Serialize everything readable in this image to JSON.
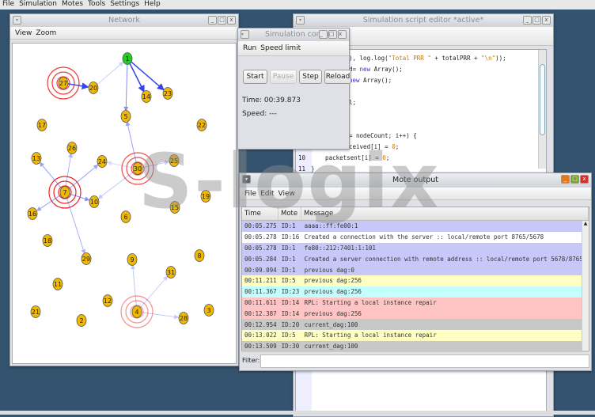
{
  "menubar": [
    "File",
    "Simulation",
    "Motes",
    "Tools",
    "Settings",
    "Help"
  ],
  "network": {
    "title": "Network",
    "menu": [
      "View",
      "Zoom"
    ],
    "nodes": [
      "1",
      "2",
      "3",
      "4",
      "5",
      "6",
      "7",
      "8",
      "9",
      "10",
      "11",
      "12",
      "13",
      "14",
      "15",
      "16",
      "17",
      "18",
      "19",
      "20",
      "21",
      "22",
      "23",
      "24",
      "25",
      "26",
      "27",
      "28",
      "29",
      "30",
      "31"
    ],
    "root_node": "1",
    "edges": [
      [
        "27",
        "20",
        1
      ],
      [
        "20",
        "1",
        0.25
      ],
      [
        "1",
        "14",
        1
      ],
      [
        "1",
        "23",
        1
      ],
      [
        "1",
        "5",
        0.6
      ],
      [
        "30",
        "5",
        0.5
      ],
      [
        "30",
        "24",
        0.2
      ],
      [
        "30",
        "25",
        0.3
      ],
      [
        "30",
        "10",
        0.3
      ],
      [
        "7",
        "13",
        0.5
      ],
      [
        "7",
        "26",
        0.4
      ],
      [
        "7",
        "24",
        0.5
      ],
      [
        "7",
        "16",
        0.5
      ],
      [
        "7",
        "10",
        0.6
      ],
      [
        "7",
        "29",
        0.4
      ],
      [
        "4",
        "9",
        0.3
      ],
      [
        "4",
        "31",
        0.25
      ],
      [
        "4",
        "28",
        0.3
      ]
    ],
    "transmitting": [
      [
        "27",
        0.9
      ],
      [
        "30",
        0.8
      ],
      [
        "7",
        1
      ],
      [
        "4",
        0.5
      ]
    ],
    "colors": {
      "node": "#f0b800",
      "root": "#22cc22",
      "edge": "#3344ee",
      "ring": "#ee2222"
    }
  },
  "editor": {
    "title": "Simulation script editor *active*",
    "lines": [
      {
        "num": "",
        "pre": "), log.log(",
        "str": "\"Total PRR \"",
        "post": " + totalPRR + ",
        "str2": "\"\\n\"",
        "post2": "));"
      },
      {
        "num": "",
        "pre": "d= ",
        "kw": "new",
        "post": " Array();"
      },
      {
        "num": "",
        "pre": "",
        "kw": "new",
        "post": " Array();"
      },
      {
        "num": "",
        "pre": ""
      },
      {
        "num": "",
        "pre": "l;"
      },
      {
        "num": "",
        "pre": ""
      },
      {
        "num": "",
        "pre": ""
      },
      {
        "num": "",
        "pre": "= nodeCount; i++) {"
      },
      {
        "num": "",
        "pre": "ceived[i] = ",
        "str": "0",
        "post": ";"
      },
      {
        "num": "10",
        "pre": "    packetsent[i] = ",
        "str": "0",
        "post": ";"
      },
      {
        "num": "11",
        "pre": "}"
      }
    ]
  },
  "sim_control": {
    "title": "Simulation control",
    "menu": [
      "Run",
      "Speed limit"
    ],
    "buttons": {
      "start": "Start",
      "pause": "Pause",
      "step": "Step",
      "reload": "Reload"
    },
    "time": "Time: 00:39.873",
    "speed": "Speed: ---"
  },
  "mote_output": {
    "title": "Mote output",
    "menu": [
      "File",
      "Edit",
      "View"
    ],
    "columns": [
      "Time",
      "Mote",
      "Message"
    ],
    "rows": [
      {
        "time": "00:05.275",
        "mote": "ID:1",
        "msg": "aaaa::ff:fe00:1",
        "color": "#c8c8f8"
      },
      {
        "time": "00:05.278",
        "mote": "ID:16",
        "msg": "Created a connection with the server :: local/remote port 8765/5678",
        "color": "#ffffff"
      },
      {
        "time": "00:05.278",
        "mote": "ID:1",
        "msg": "fe80::212:7401:1:101",
        "color": "#c8c8f8"
      },
      {
        "time": "00:05.284",
        "mote": "ID:1",
        "msg": "Created a server connection with remote address :: local/remote port 5678/8765",
        "color": "#c8c8f8"
      },
      {
        "time": "00:09.094",
        "mote": "ID:1",
        "msg": "previous dag:0",
        "color": "#c8c8f8"
      },
      {
        "time": "00:11.211",
        "mote": "ID:5",
        "msg": "previous dag:256",
        "color": "#ffffc4"
      },
      {
        "time": "00:11.367",
        "mote": "ID:23",
        "msg": "previous dag:256",
        "color": "#c4ffff"
      },
      {
        "time": "00:11.611",
        "mote": "ID:14",
        "msg": "RPL: Starting a local instance repair",
        "color": "#ffc4c4"
      },
      {
        "time": "00:12.387",
        "mote": "ID:14",
        "msg": "previous dag:256",
        "color": "#ffc4c4"
      },
      {
        "time": "00:12.954",
        "mote": "ID:20",
        "msg": "current_dag:100",
        "color": "#c8c8c8"
      },
      {
        "time": "00:13.022",
        "mote": "ID:5",
        "msg": "RPL: Starting a local instance repair",
        "color": "#ffffc4"
      },
      {
        "time": "00:13.509",
        "mote": "ID:30",
        "msg": "current_dag:100",
        "color": "#c8c8c8"
      }
    ],
    "filter_label": "Filter:",
    "filter_value": ""
  },
  "watermark": "S-logix"
}
